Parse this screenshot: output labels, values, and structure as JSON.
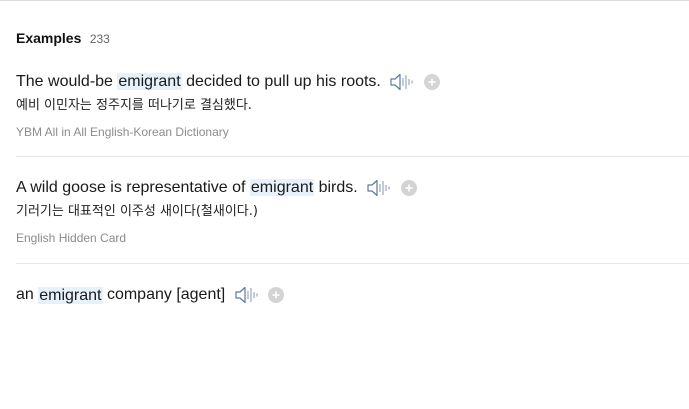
{
  "header": {
    "title": "Examples",
    "count": "233"
  },
  "examples": [
    {
      "en_before": "The would-be ",
      "en_keyword": "emigrant",
      "en_after": " decided to pull up his roots.",
      "ko": "예비 이민자는 정주지를 떠나기로 결심했다.",
      "source": "YBM All in All English-Korean Dictionary",
      "icons": [
        "speaker-icon",
        "plus-icon"
      ]
    },
    {
      "en_before": "A wild goose is representative of ",
      "en_keyword": "emigrant",
      "en_after": " birds.",
      "ko": "기러기는 대표적인 이주성 새이다(철새이다.)",
      "source": "English Hidden Card",
      "icons": [
        "speaker-icon",
        "plus-icon"
      ]
    },
    {
      "en_before": "an ",
      "en_keyword": "emigrant",
      "en_after": " company [agent]",
      "icons": [
        "speaker-icon",
        "plus-icon"
      ]
    }
  ],
  "colors": {
    "highlight": "#e6f1fb",
    "source_text": "#8c8c8c",
    "divider": "#e8e8e8",
    "icon_gray": "#c8c8c8",
    "speaker_blue": "#5d7aa1"
  }
}
